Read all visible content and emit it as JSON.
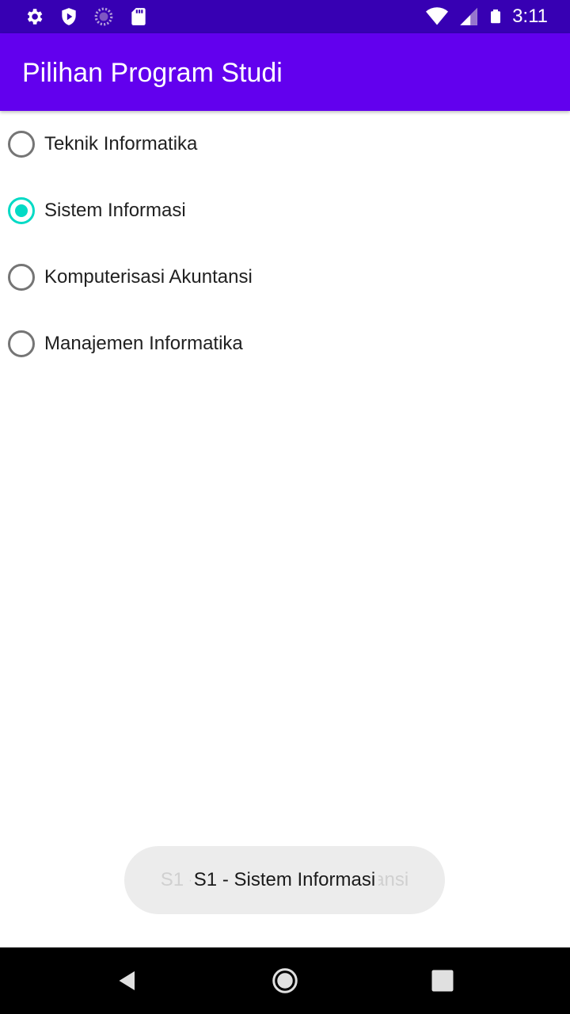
{
  "status_bar": {
    "time": "3:11",
    "left_icons": [
      "gear-icon",
      "shield-icon",
      "sync-icon",
      "sd-card-icon"
    ],
    "right_icons": [
      "wifi-icon",
      "signal-icon",
      "battery-icon"
    ]
  },
  "app_bar": {
    "title": "Pilihan Program Studi"
  },
  "options": [
    {
      "label": "Teknik Informatika",
      "checked": false
    },
    {
      "label": "Sistem Informasi",
      "checked": true
    },
    {
      "label": "Komputerisasi Akuntansi",
      "checked": false
    },
    {
      "label": "Manajemen Informatika",
      "checked": false
    }
  ],
  "toast": {
    "message": "S1 - Sistem Informasi",
    "fading_message": "S1 - Komputerisasi Akuntansi"
  },
  "nav_bar": {
    "icons": [
      "back-icon",
      "home-icon",
      "recents-icon"
    ]
  },
  "colors": {
    "status_bar": "#3700b3",
    "app_bar": "#6200ee",
    "accent": "#03dac5"
  }
}
